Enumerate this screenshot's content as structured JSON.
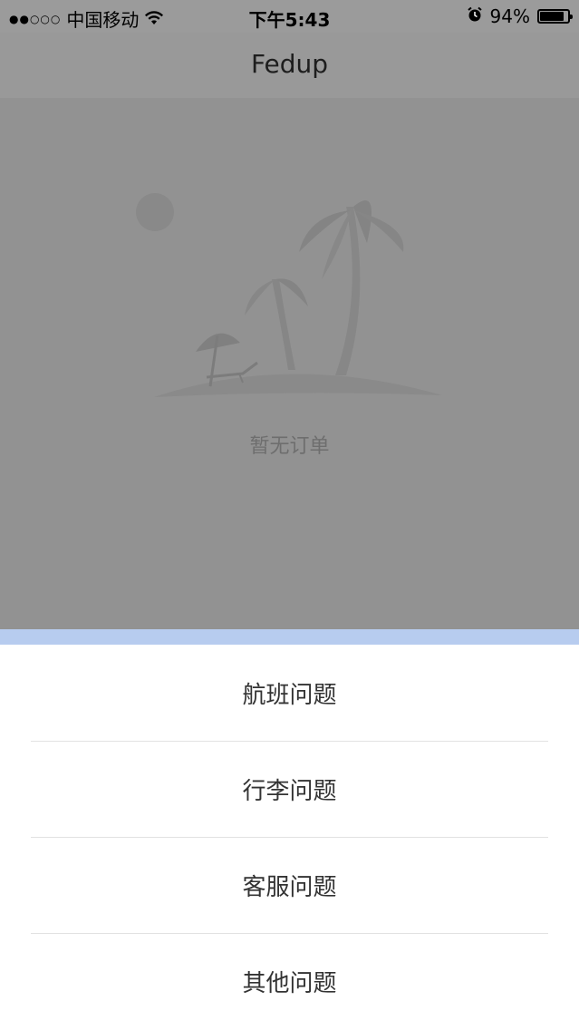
{
  "status_bar": {
    "signal": "●●○○○",
    "carrier": "中国移动",
    "wifi_icon": "wifi-icon",
    "time": "下午5:43",
    "alarm_icon": "alarm-icon",
    "battery_percent": "94%",
    "battery_level": 0.94
  },
  "header": {
    "title": "Fedup"
  },
  "empty_state": {
    "illustration_icon": "beach-island-icon",
    "text": "暂无订单"
  },
  "action_sheet": {
    "accent_color": "#b7ccef",
    "items": [
      {
        "label": "航班问题"
      },
      {
        "label": "行李问题"
      },
      {
        "label": "客服问题"
      },
      {
        "label": "其他问题"
      }
    ]
  }
}
